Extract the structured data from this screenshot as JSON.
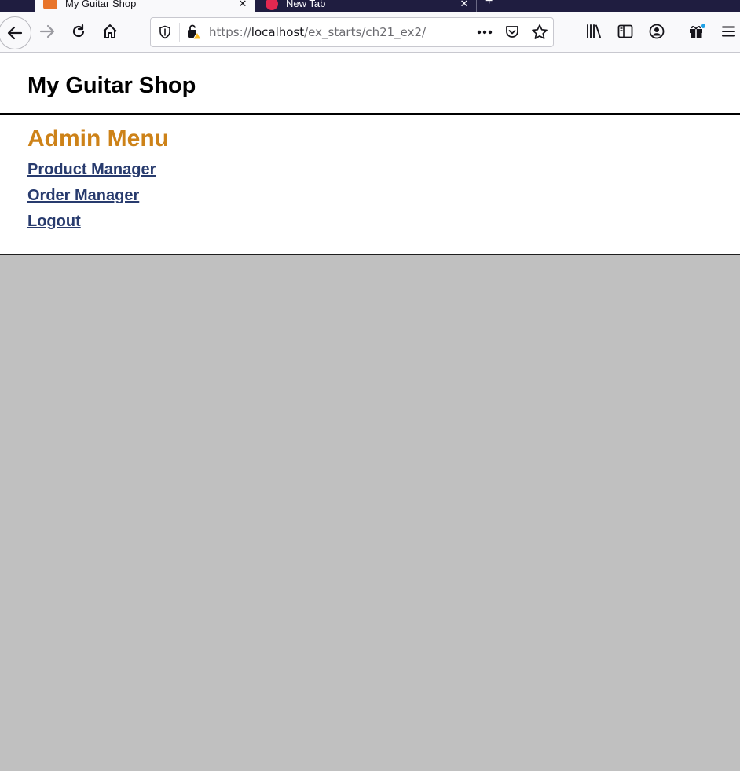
{
  "browser": {
    "tabs": [
      {
        "title": "My Guitar Shop",
        "active": true
      },
      {
        "title": "New Tab",
        "active": false
      }
    ],
    "url": {
      "scheme": "https://",
      "host": "localhost",
      "path": "/ex_starts/ch21_ex2/"
    },
    "icons": {
      "back": "back-arrow-icon",
      "forward": "forward-arrow-icon",
      "reload": "reload-icon",
      "home": "home-icon",
      "tracking": "tracking-shield-icon",
      "security": "insecure-lock-icon",
      "page_actions": "more-dots-icon",
      "pocket": "pocket-icon",
      "bookmark": "star-icon",
      "library": "library-icon",
      "sidebar": "sidebar-icon",
      "account": "account-icon",
      "whats_new": "gift-icon",
      "menu": "hamburger-menu-icon"
    },
    "colors": {
      "tabstrip": "#1f1d40",
      "toolbar": "#f9f9fb"
    }
  },
  "page": {
    "site_title": "My Guitar Shop",
    "section_heading": "Admin Menu",
    "menu_links": [
      {
        "label": "Product Manager"
      },
      {
        "label": "Order Manager"
      },
      {
        "label": "Logout"
      }
    ],
    "colors": {
      "heading": "#cd8218",
      "link": "#283b6e",
      "background": "#c0c0c0"
    }
  }
}
